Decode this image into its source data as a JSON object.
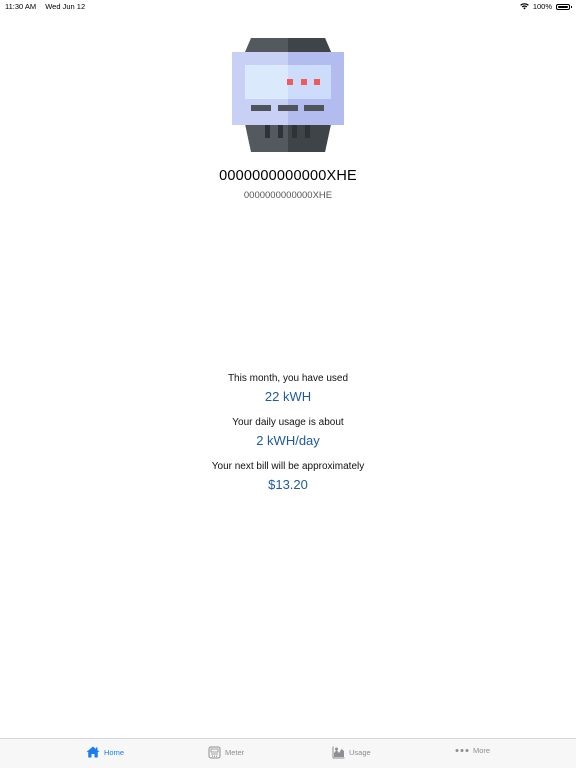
{
  "status_bar": {
    "time": "11:30 AM",
    "date": "Wed Jun 12",
    "battery": "100%"
  },
  "meter": {
    "id_title": "0000000000000XHE",
    "id_subtitle": "0000000000000XHE"
  },
  "stats": [
    {
      "label": "This month, you have used",
      "value": "22 kWH"
    },
    {
      "label": "Your daily usage is about",
      "value": "2 kWH/day"
    },
    {
      "label": "Your next bill will be approximately",
      "value": "$13.20"
    }
  ],
  "tabs": [
    {
      "label": "Home",
      "icon": "house-icon",
      "active": true
    },
    {
      "label": "Meter",
      "icon": "meter-icon",
      "active": false
    },
    {
      "label": "Usage",
      "icon": "usage-chart-icon",
      "active": false
    },
    {
      "label": "More",
      "icon": "ellipsis-icon",
      "active": false
    }
  ],
  "colors": {
    "accent": "#1a7cf4",
    "value_text": "#1f5a9c",
    "inactive_tab": "#8e8e93"
  }
}
